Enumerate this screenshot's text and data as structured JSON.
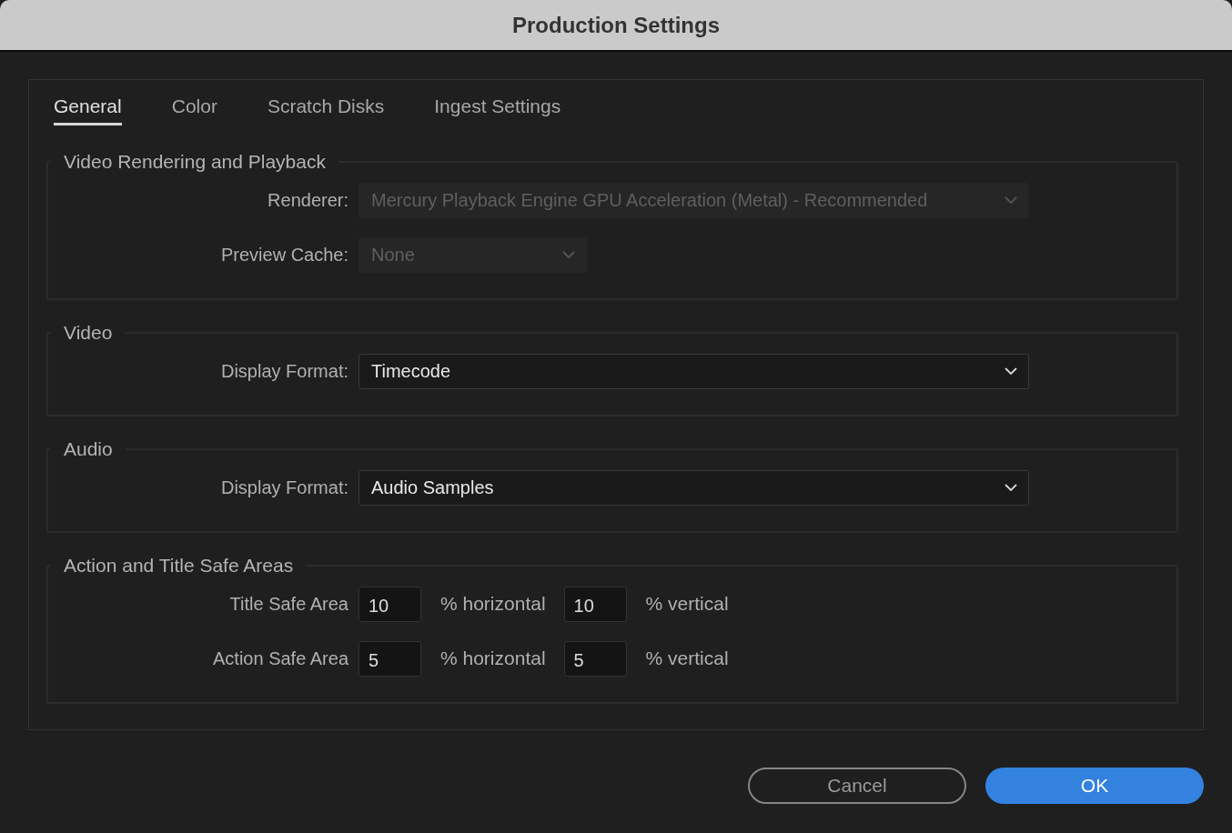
{
  "window": {
    "title": "Production Settings"
  },
  "tabs": [
    {
      "label": "General",
      "selected": true
    },
    {
      "label": "Color",
      "selected": false
    },
    {
      "label": "Scratch Disks",
      "selected": false
    },
    {
      "label": "Ingest Settings",
      "selected": false
    }
  ],
  "sections": [
    {
      "title": "Video Rendering and Playback",
      "rows": [
        {
          "kind": "select",
          "label": "Renderer:",
          "value": "Mercury Playback Engine GPU Acceleration (Metal) - Recommended",
          "disabled": true,
          "wide": true
        },
        {
          "kind": "select",
          "label": "Preview Cache:",
          "value": "None",
          "disabled": true,
          "wide": false
        }
      ]
    },
    {
      "title": "Video",
      "rows": [
        {
          "kind": "select",
          "label": "Display Format:",
          "value": "Timecode",
          "disabled": false,
          "wide": true
        }
      ]
    },
    {
      "title": "Audio",
      "rows": [
        {
          "kind": "select",
          "label": "Display Format:",
          "value": "Audio Samples",
          "disabled": false,
          "wide": true
        }
      ]
    },
    {
      "title": "Action and Title Safe Areas",
      "rows": [
        {
          "kind": "inputs",
          "label": "Title Safe Area",
          "fields": [
            {
              "value": "10",
              "unit": "% horizontal"
            },
            {
              "value": "10",
              "unit": "% vertical"
            }
          ]
        },
        {
          "kind": "inputs",
          "label": "Action Safe Area",
          "fields": [
            {
              "value": "5",
              "unit": "% horizontal"
            },
            {
              "value": "5",
              "unit": "% vertical"
            }
          ]
        }
      ]
    }
  ],
  "buttons": [
    {
      "label": "Cancel",
      "kind": "secondary"
    },
    {
      "label": "OK",
      "kind": "primary"
    }
  ]
}
